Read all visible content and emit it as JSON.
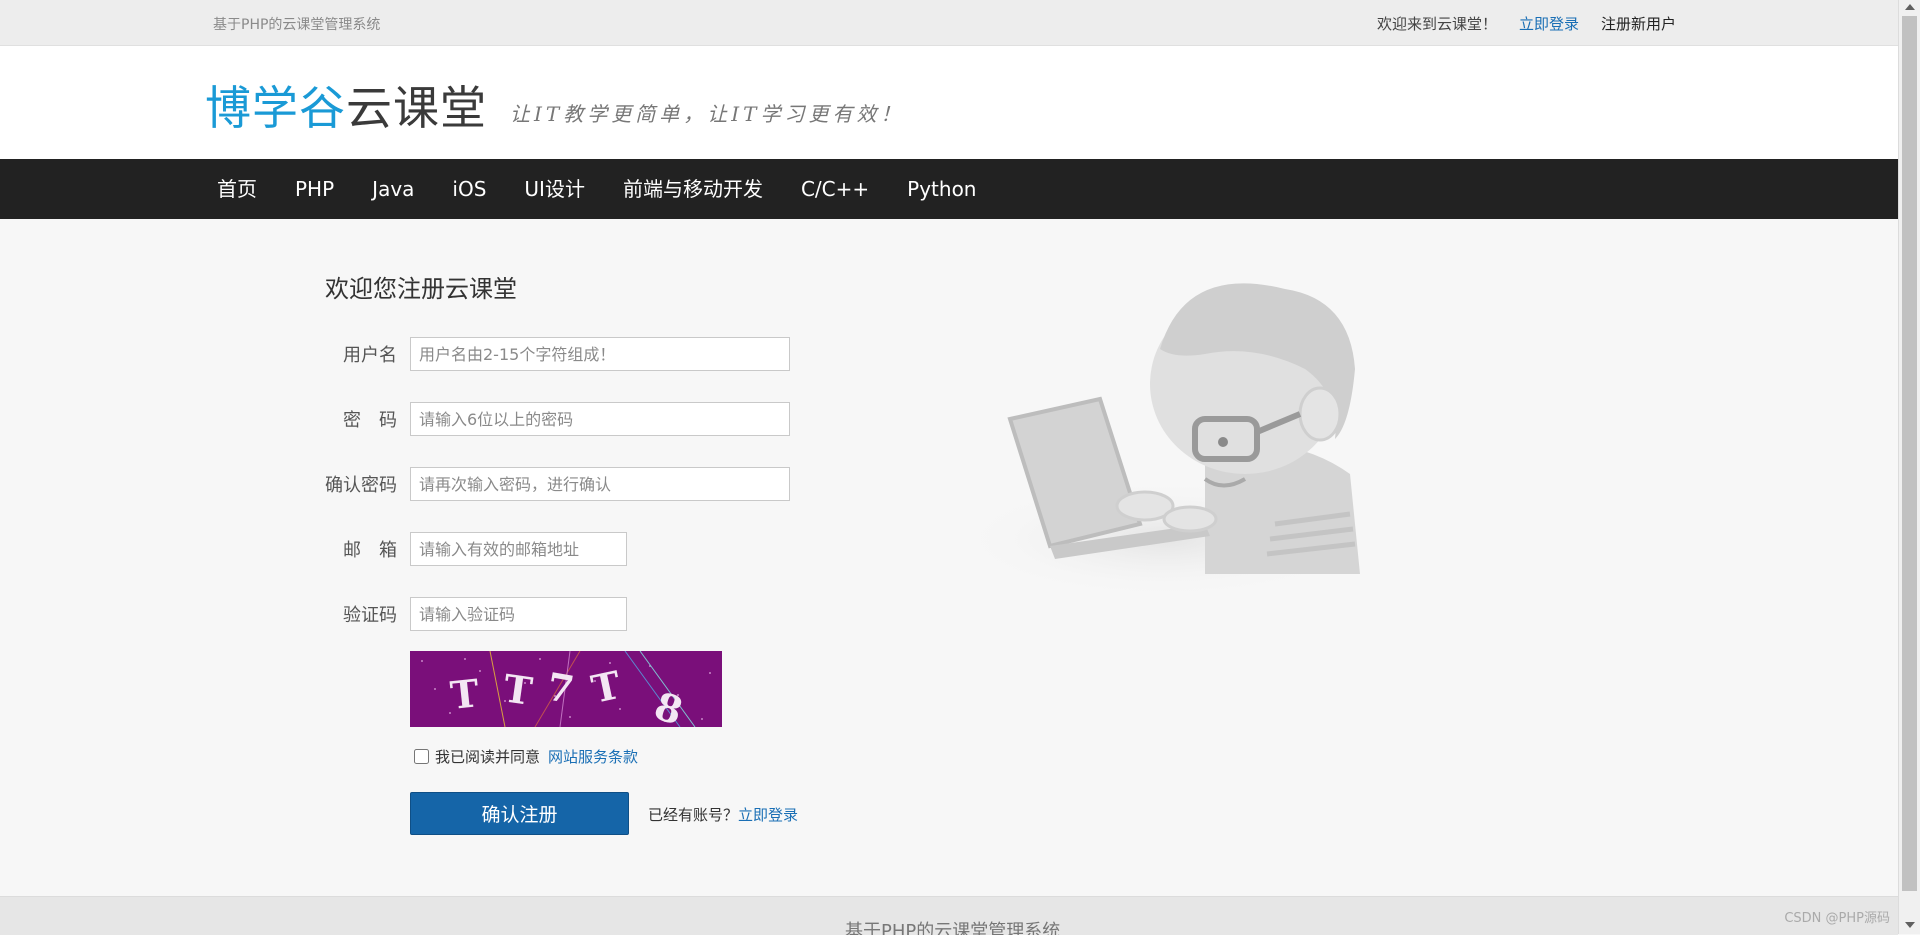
{
  "topbar": {
    "site_name": "基于PHP的云课堂管理系统",
    "welcome": "欢迎来到云课堂！",
    "login_link": "立即登录",
    "register_link": "注册新用户"
  },
  "header": {
    "logo_part1": "博学谷",
    "logo_part2": "云课堂",
    "slogan": "让IT教学更简单，让IT学习更有效！"
  },
  "nav": {
    "items": [
      "首页",
      "PHP",
      "Java",
      "iOS",
      "UI设计",
      "前端与移动开发",
      "C/C++",
      "Python"
    ]
  },
  "form": {
    "title": "欢迎您注册云课堂",
    "username_label": "用户名",
    "username_placeholder": "用户名由2-15个字符组成！",
    "password_label": "密　码",
    "password_placeholder": "请输入6位以上的密码",
    "confirm_label": "确认密码",
    "confirm_placeholder": "请再次输入密码，进行确认",
    "email_label": "邮　箱",
    "email_placeholder": "请输入有效的邮箱地址",
    "captcha_label": "验证码",
    "captcha_placeholder": "请输入验证码",
    "captcha_text": "TT7T8",
    "agree_text": "我已阅读并同意",
    "terms_link": "网站服务条款",
    "submit_label": "确认注册",
    "has_account_text": "已经有账号？",
    "login_link": "立即登录"
  },
  "footer": {
    "text": "基于PHP的云课堂管理系统"
  },
  "watermark": "CSDN @PHP源码",
  "colors": {
    "nav_bg": "#222222",
    "primary_button": "#1565a8",
    "link": "#1a6fb5",
    "logo_blue": "#1a9ad6",
    "captcha_bg": "#7a0f7a"
  }
}
